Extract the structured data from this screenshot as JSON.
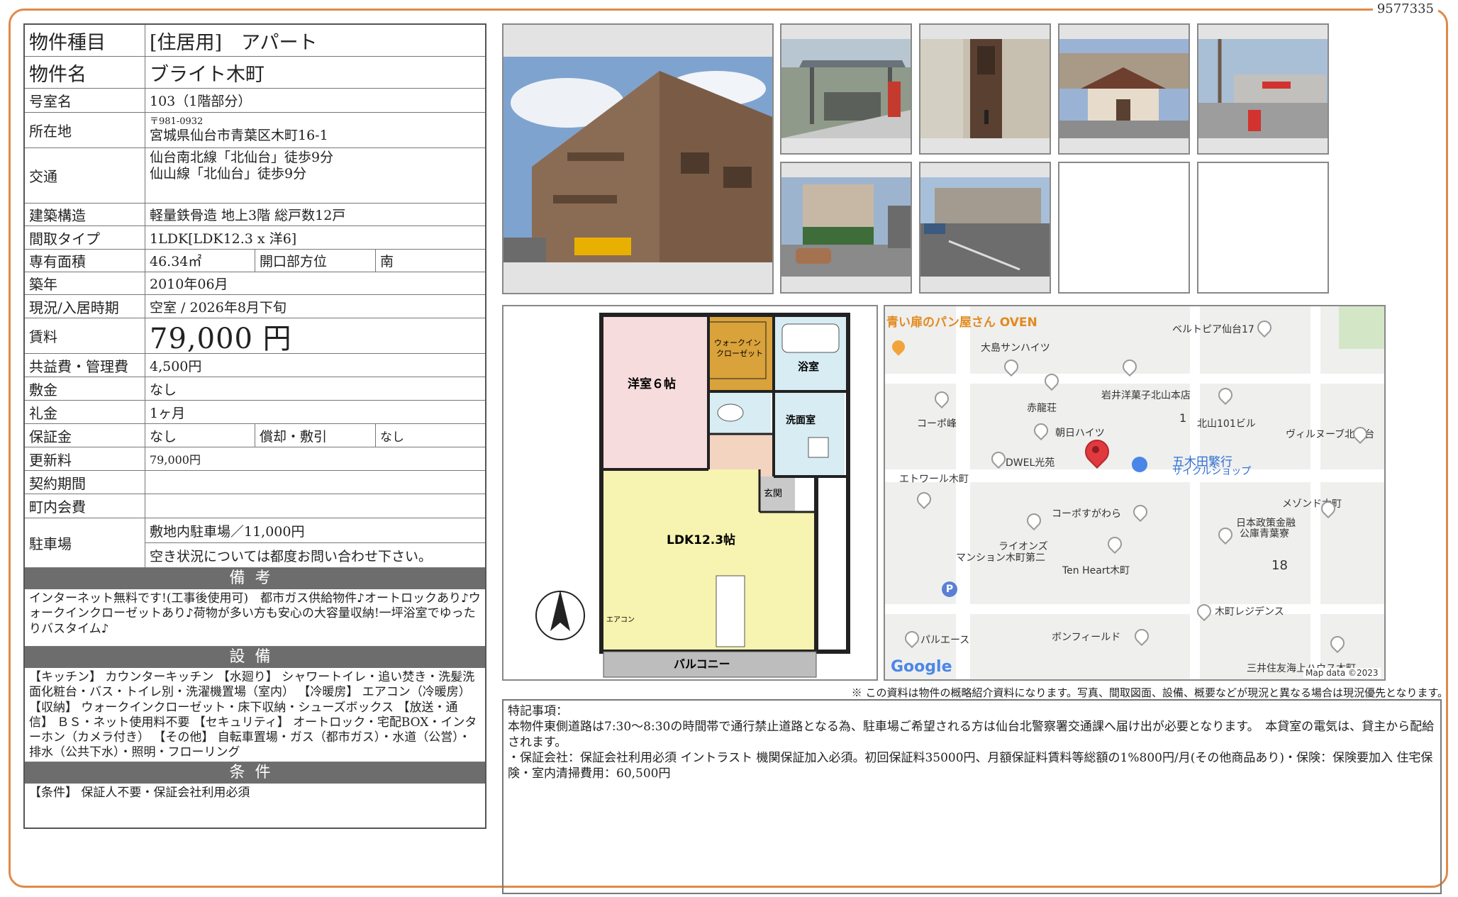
{
  "doc_id": "9577335",
  "table": {
    "type": {
      "label": "物件種目",
      "value": "[住居用]　アパート"
    },
    "name": {
      "label": "物件名",
      "value": "ブライト木町"
    },
    "room": {
      "label": "号室名",
      "value": "103（1階部分）"
    },
    "address": {
      "label": "所在地",
      "zip": "〒981-0932",
      "value": "宮城県仙台市青葉区木町16-1"
    },
    "access": {
      "label": "交通",
      "line1": "仙台南北線「北仙台」徒歩9分",
      "line2": "仙山線「北仙台」徒歩9分"
    },
    "structure": {
      "label": "建築構造",
      "value": "軽量鉄骨造 地上3階 総戸数12戸"
    },
    "layout": {
      "label": "間取タイプ",
      "value": "1LDK[LDK12.3 x 洋6]"
    },
    "area": {
      "label": "専有面積",
      "value": "46.34㎡",
      "dir_label": "開口部方位",
      "dir_value": "南"
    },
    "built": {
      "label": "築年",
      "value": "2010年06月"
    },
    "status": {
      "label": "現況/入居時期",
      "value": "空室 / 2026年8月下旬"
    },
    "rent": {
      "label": "賃料",
      "value": "79,000 円"
    },
    "fee": {
      "label": "共益費・管理費",
      "value": "4,500円"
    },
    "deposit": {
      "label": "敷金",
      "value": "なし"
    },
    "keymoney": {
      "label": "礼金",
      "value": "1ヶ月"
    },
    "guarantee": {
      "label": "保証金",
      "value": "なし",
      "amort_label": "償却・敷引",
      "amort_value": "なし"
    },
    "renewal": {
      "label": "更新料",
      "value": "79,000円"
    },
    "contract": {
      "label": "契約期間",
      "value": ""
    },
    "community": {
      "label": "町内会費",
      "value": ""
    },
    "parking": {
      "label": "駐車場",
      "line1": "敷地内駐車場／11,000円",
      "line2": "空き状況については都度お問い合わせ下さい。"
    }
  },
  "remarks": {
    "title": "備考",
    "text": "インターネット無料です!(工事後使用可)　都市ガス供給物件♪オートロックあり♪ウォークインクローゼットあり♪荷物が多い方も安心の大容量収納!一坪浴室でゆったりバスタイム♪"
  },
  "equipment": {
    "title": "設備",
    "text": "【キッチン】 カウンターキッチン 【水廻り】 シャワートイレ・追い焚き・洗髪洗面化粧台・バス・トイレ別・洗濯機置場（室内） 【冷暖房】 エアコン（冷暖房） 【収納】 ウォークインクローゼット・床下収納・シューズボックス 【放送・通信】 ＢＳ・ネット使用料不要 【セキュリティ】 オートロック・宅配BOX・インターホン（カメラ付き） 【その他】 自転車置場・ガス（都市ガス）・水道（公営）・排水（公共下水）・照明・フローリング"
  },
  "conditions": {
    "title": "条件",
    "text": "【条件】 保証人不要・保証会社利用必須"
  },
  "floorplan": {
    "room1": "洋室６帖",
    "wic": "ウォークイン\nクローゼット",
    "bath": "浴室",
    "wash": "洗面室",
    "entrance": "玄関",
    "ldk": "LDK12.3帖",
    "balcony": "バルコニー",
    "aircon": "エアコン"
  },
  "map": {
    "labels": [
      "青い扉のパン屋さん OVEN",
      "ベルトピア仙台17",
      "大島サンハイツ",
      "岩井洋菓子北山本店",
      "コーポ峰",
      "赤龍荘",
      "北山101ビル",
      "朝日ハイツ",
      "ヴィルヌーブ北仙台",
      "五木田繁行",
      "サイクルショップ",
      "DWEL光苑",
      "エトワール木町",
      "コーポすがわら",
      "メゾンド木町",
      "日本政策金融",
      "公庫青葉寮",
      "ライオンズ",
      "マンション木町第二",
      "Ten Heart木町",
      "木町レジデンス",
      "パルエース",
      "ボンフィールド",
      "三井住友海上ハウス木町",
      "1",
      "18"
    ],
    "brand": "Google",
    "attribution": "Map data ©2023"
  },
  "disclaimer": "※ この資料は物件の概略紹介資料になります。写真、間取図面、設備、概要などが現況と異なる場合は現況優先となります。",
  "special": {
    "title": "特記事項：",
    "line1": "本物件東側道路は7:30〜8:30の時間帯で通行禁止道路となる為、駐車場ご希望される方は仙台北警察署交通課へ届け出が必要となります。　本貸室の電気は、貸主から配給されます。",
    "line2": "・保証会社：保証会社利用必須 イントラスト 機関保証加入必須。初回保証料35000円、月額保証料賃料等総額の1%800円/月(その他商品あり)・保険：保険要加入 住宅保険・室内清掃費用：60,500円"
  },
  "colors": {
    "accent": "#e08a4a",
    "header_gray": "#6d6d6d",
    "ldk": "#f7f3b0",
    "room": "#f6dcdc",
    "wic": "#d9a23a",
    "bath": "#d7ecf3",
    "hall": "#f3d4c0"
  }
}
